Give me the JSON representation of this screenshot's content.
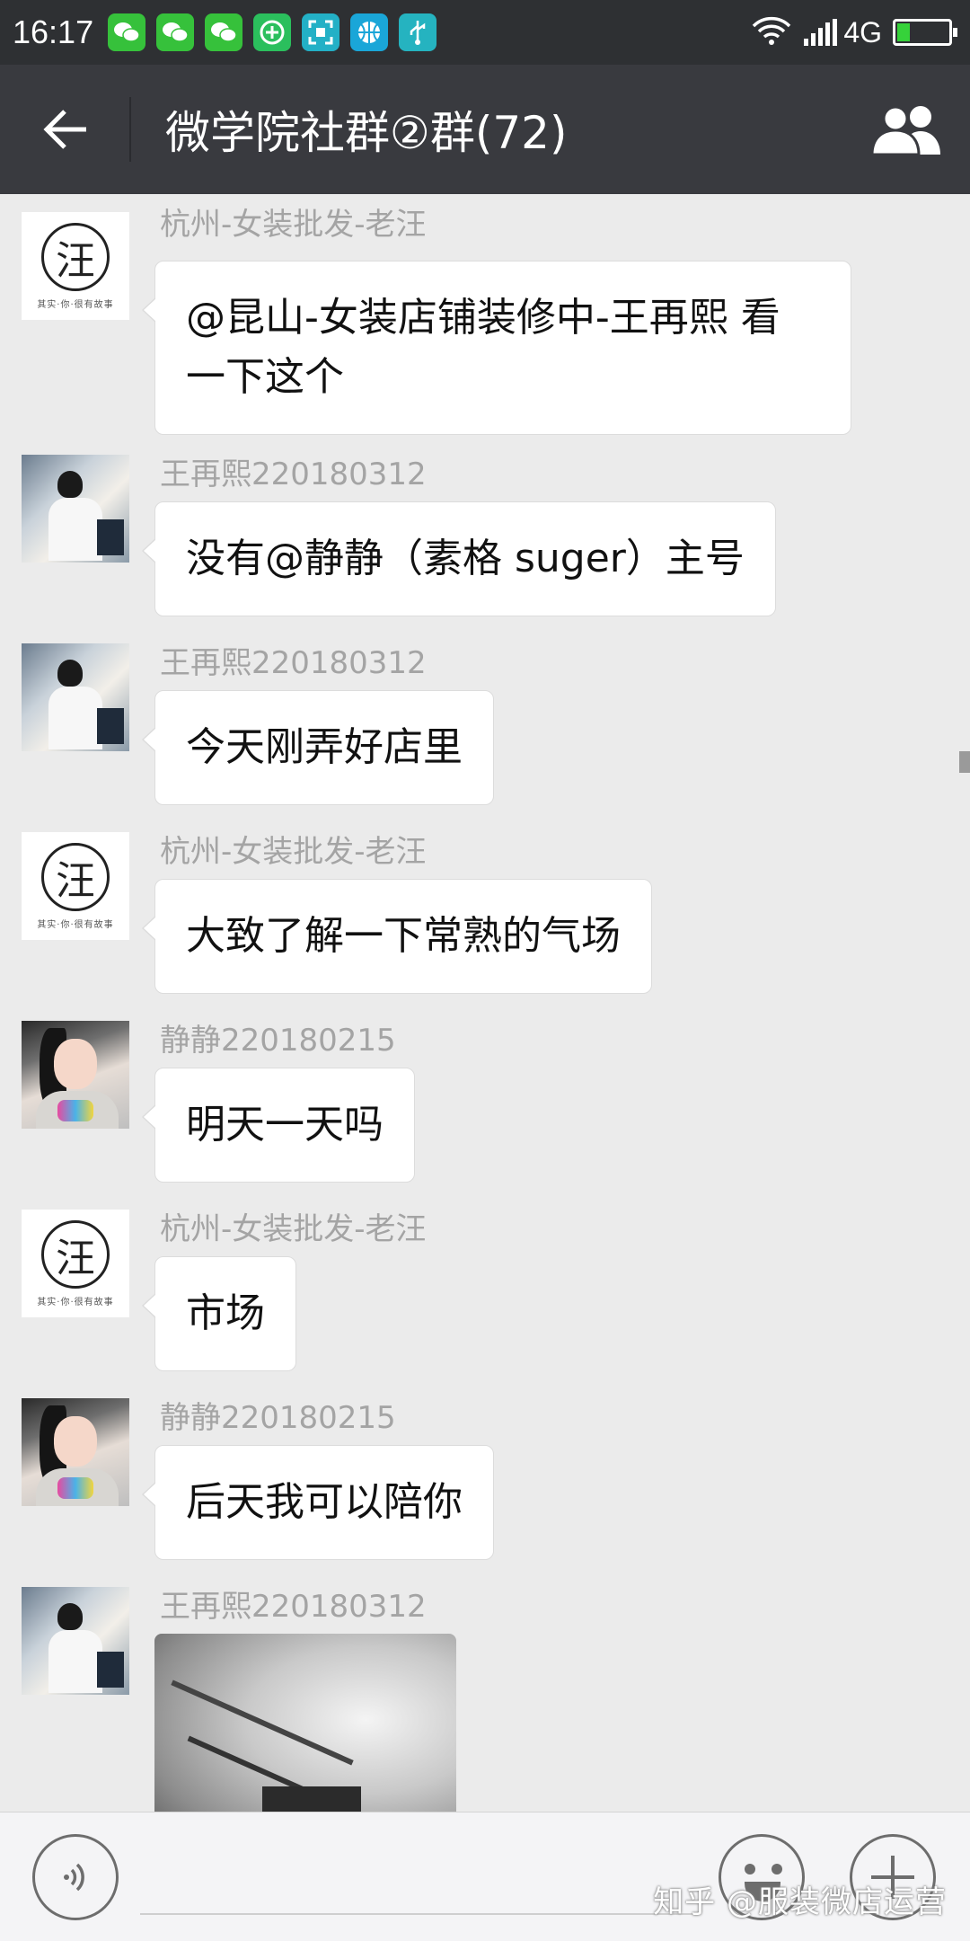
{
  "status_bar": {
    "time": "16:17",
    "network": "4G",
    "battery_level": 0.25,
    "notifications": [
      "wechat-icon",
      "wechat-icon",
      "wechat-icon",
      "plus-app-icon",
      "scan-icon",
      "basketball-icon",
      "usb-icon"
    ]
  },
  "header": {
    "title": "微学院社群②群(72)"
  },
  "messages": [
    {
      "sender": "杭州-女装批发-老汪",
      "avatar": "logo-avatar",
      "avatar_char": "汪",
      "avatar_tagline": "其实·你·很有故事",
      "type": "text",
      "text_lines": [
        "@昆山-女装店铺装修中-王再熙  看",
        "一下这个"
      ]
    },
    {
      "sender": "王再熙220180312",
      "avatar": "girl-sitting-avatar",
      "type": "text",
      "text": "没有@静静（素格 suger）主号"
    },
    {
      "sender": "王再熙220180312",
      "avatar": "girl-sitting-avatar",
      "type": "text",
      "text": "今天刚弄好店里"
    },
    {
      "sender": "杭州-女装批发-老汪",
      "avatar": "logo-avatar",
      "avatar_char": "汪",
      "avatar_tagline": "其实·你·很有故事",
      "type": "text",
      "text": "大致了解一下常熟的气场"
    },
    {
      "sender": "静静220180215",
      "avatar": "girl-selfie-avatar",
      "type": "text",
      "text": "明天一天吗"
    },
    {
      "sender": "杭州-女装批发-老汪",
      "avatar": "logo-avatar",
      "avatar_char": "汪",
      "avatar_tagline": "其实·你·很有故事",
      "type": "text",
      "text": "市场"
    },
    {
      "sender": "静静220180215",
      "avatar": "girl-selfie-avatar",
      "type": "text",
      "text": "后天我可以陪你"
    },
    {
      "sender": "王再熙220180312",
      "avatar": "girl-sitting-avatar",
      "type": "image",
      "image": "store-interior-photo"
    }
  ],
  "input_bar": {
    "value": "",
    "watermark": "知乎 @服装微店运营"
  },
  "colors": {
    "status_bar": "#2e3033",
    "title_bar": "#393a3f",
    "chat_bg": "#ebebeb",
    "bubble": "#ffffff",
    "sender_name": "#a4a4a4"
  }
}
